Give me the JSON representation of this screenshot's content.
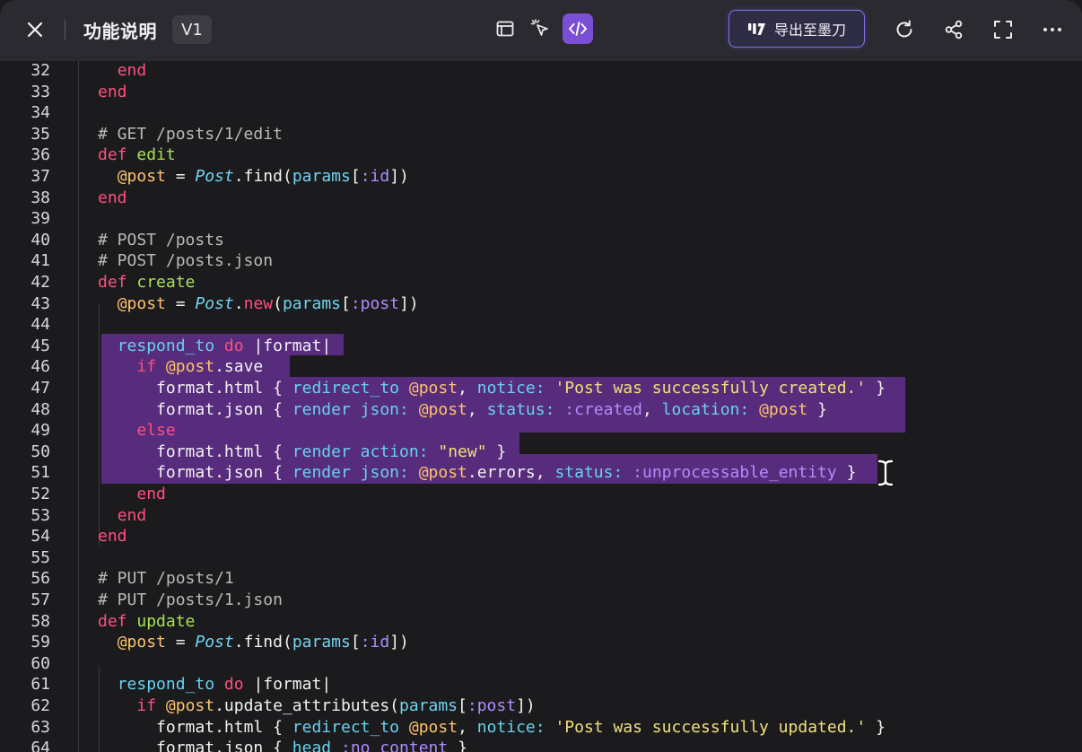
{
  "toolbar": {
    "title": "功能说明",
    "version": "V1",
    "export_label": "导出至墨刀",
    "icons": [
      "close-icon",
      "preview-icon",
      "select-cursor-icon",
      "code-icon",
      "modao-logo-icon",
      "refresh-icon",
      "share-icon",
      "fullscreen-icon",
      "more-icon"
    ],
    "accent_color": "#7a4fd6"
  },
  "editor": {
    "selection_color": "#5b2d82",
    "lines": [
      {
        "n": "32",
        "t": "    end"
      },
      {
        "n": "33",
        "t": "  end"
      },
      {
        "n": "34",
        "t": ""
      },
      {
        "n": "35",
        "t": "  # GET /posts/1/edit"
      },
      {
        "n": "36",
        "t": "  def edit"
      },
      {
        "n": "37",
        "t": "    @post = Post.find(params[:id])"
      },
      {
        "n": "38",
        "t": "  end"
      },
      {
        "n": "39",
        "t": ""
      },
      {
        "n": "40",
        "t": "  # POST /posts"
      },
      {
        "n": "41",
        "t": "  # POST /posts.json"
      },
      {
        "n": "42",
        "t": "  def create"
      },
      {
        "n": "43",
        "t": "    @post = Post.new(params[:post])"
      },
      {
        "n": "44",
        "t": ""
      },
      {
        "n": "45",
        "t": "    respond_to do |format|"
      },
      {
        "n": "46",
        "t": "      if @post.save"
      },
      {
        "n": "47",
        "t": "        format.html { redirect_to @post, notice: 'Post was successfully created.' }"
      },
      {
        "n": "48",
        "t": "        format.json { render json: @post, status: :created, location: @post }"
      },
      {
        "n": "49",
        "t": "      else"
      },
      {
        "n": "50",
        "t": "        format.html { render action: \"new\" }"
      },
      {
        "n": "51",
        "t": "        format.json { render json: @post.errors, status: :unprocessable_entity }"
      },
      {
        "n": "52",
        "t": "      end"
      },
      {
        "n": "53",
        "t": "    end"
      },
      {
        "n": "54",
        "t": "  end"
      },
      {
        "n": "55",
        "t": ""
      },
      {
        "n": "56",
        "t": "  # PUT /posts/1"
      },
      {
        "n": "57",
        "t": "  # PUT /posts/1.json"
      },
      {
        "n": "58",
        "t": "  def update"
      },
      {
        "n": "59",
        "t": "    @post = Post.find(params[:id])"
      },
      {
        "n": "60",
        "t": ""
      },
      {
        "n": "61",
        "t": "    respond_to do |format|"
      },
      {
        "n": "62",
        "t": "      if @post.update_attributes(params[:post])"
      },
      {
        "n": "63",
        "t": "        format.html { redirect_to @post, notice: 'Post was successfully updated.' }"
      },
      {
        "n": "64",
        "t": "        format.json { head :no_content }"
      }
    ]
  }
}
